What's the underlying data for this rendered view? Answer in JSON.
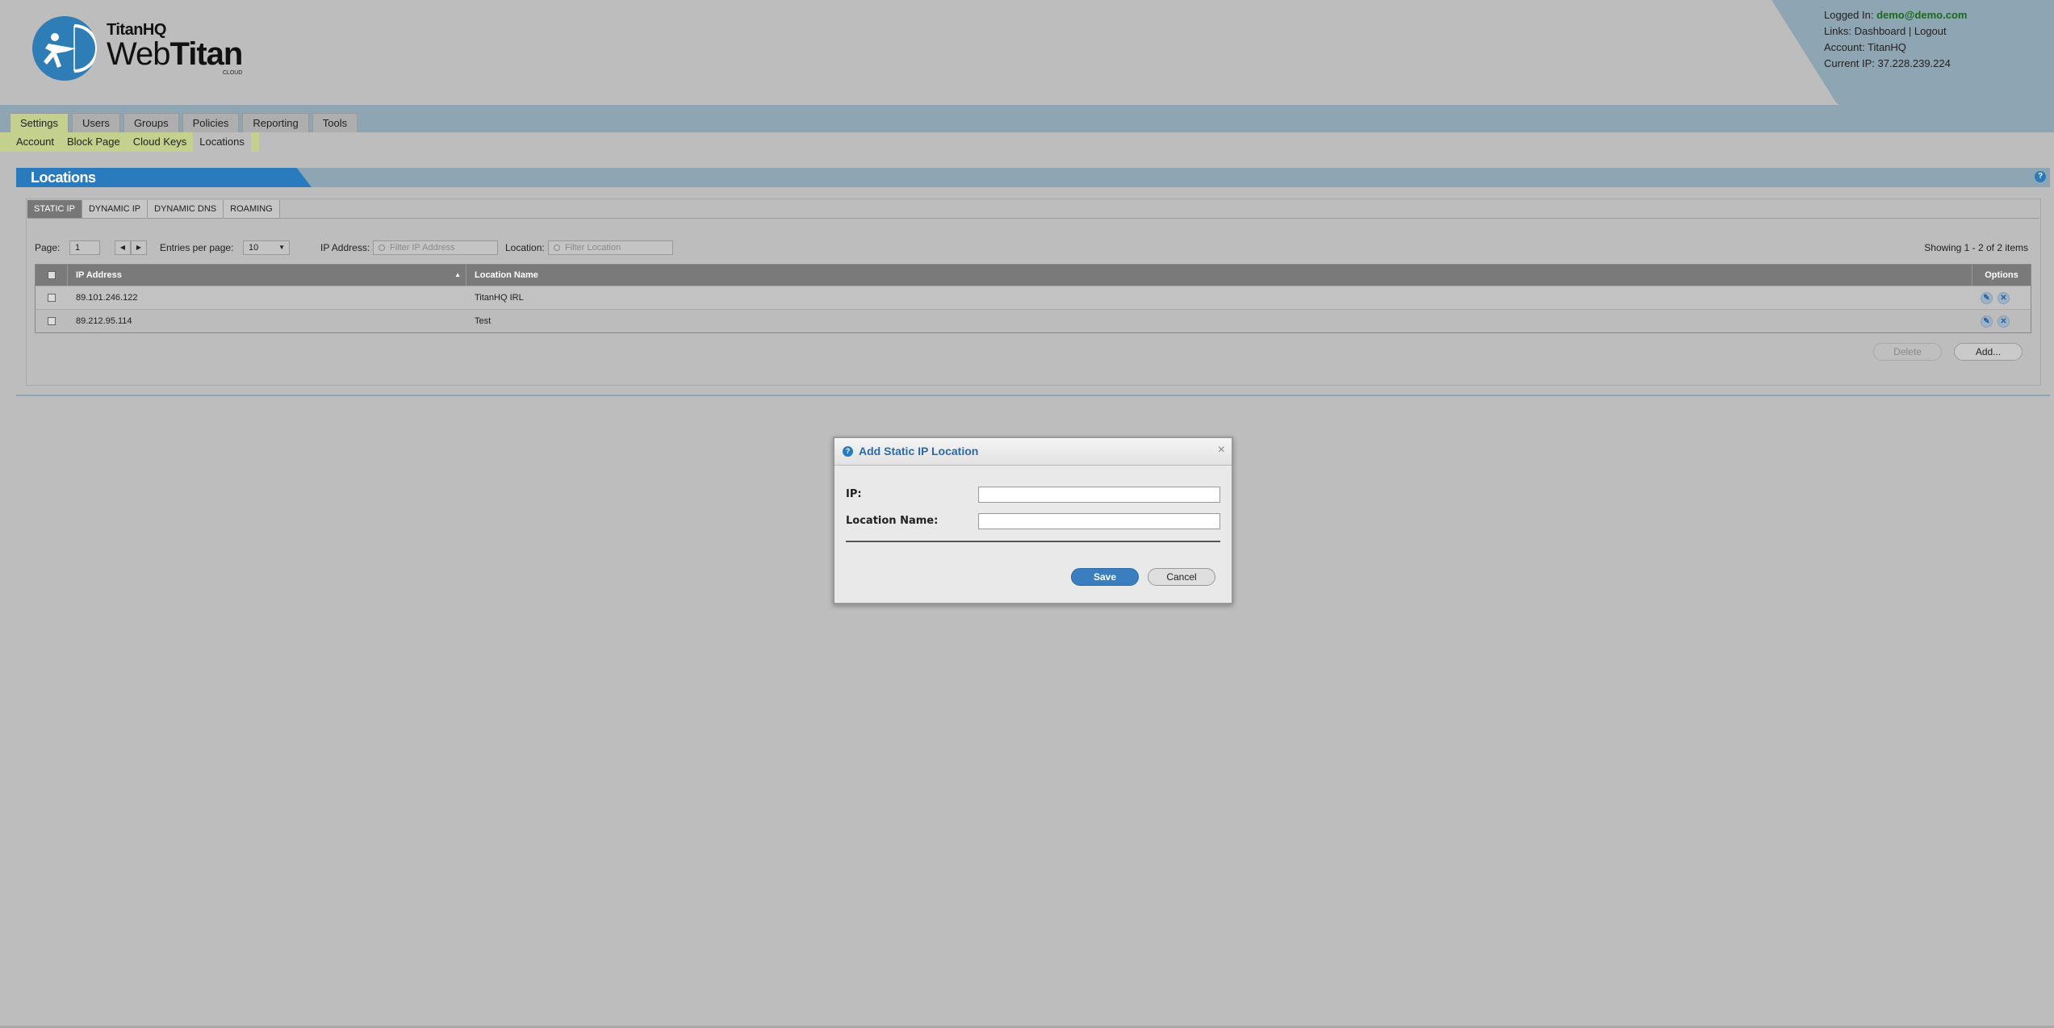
{
  "header": {
    "brand": "TitanHQ",
    "product_light": "Web",
    "product_bold": "Titan",
    "product_tag": "CLOUD"
  },
  "userinfo": {
    "logged_in_label": "Logged In:",
    "logged_in_value": "demo@demo.com",
    "links_label": "Links:",
    "link_dashboard": "Dashboard",
    "link_sep": "|",
    "link_logout": "Logout",
    "account_label": "Account:",
    "account_value": "TitanHQ",
    "ip_label": "Current IP:",
    "ip_value": "37.228.239.224"
  },
  "mainnav": {
    "items": [
      {
        "label": "Settings"
      },
      {
        "label": "Users"
      },
      {
        "label": "Groups"
      },
      {
        "label": "Policies"
      },
      {
        "label": "Reporting"
      },
      {
        "label": "Tools"
      }
    ]
  },
  "subnav": {
    "items": [
      {
        "label": "Account"
      },
      {
        "label": "Block Page"
      },
      {
        "label": "Cloud Keys"
      },
      {
        "label": "Locations"
      }
    ]
  },
  "panel": {
    "title": "Locations",
    "help": "?",
    "tabs": [
      {
        "label": "STATIC IP"
      },
      {
        "label": "DYNAMIC IP"
      },
      {
        "label": "DYNAMIC DNS"
      },
      {
        "label": "ROAMING"
      }
    ]
  },
  "toolbar": {
    "page_label": "Page:",
    "page_value": "1",
    "prev": "◀",
    "next": "▶",
    "entries_label": "Entries per page:",
    "entries_value": "10",
    "ip_filter_label": "IP Address:",
    "ip_filter_placeholder": "Filter IP Address",
    "location_filter_label": "Location:",
    "location_filter_placeholder": "Filter Location",
    "showing": "Showing 1 - 2 of 2 items"
  },
  "grid": {
    "columns": [
      "IP Address",
      "Location Name",
      "Options"
    ],
    "rows": [
      {
        "ip": "89.101.246.122",
        "location": "TitanHQ IRL"
      },
      {
        "ip": "89.212.95.114",
        "location": "Test"
      }
    ]
  },
  "actions": {
    "delete": "Delete",
    "add": "Add..."
  },
  "dialog": {
    "title": "Add Static IP Location",
    "close": "×",
    "ip_label": "IP:",
    "ip_value": "",
    "location_label": "Location Name:",
    "location_value": "",
    "save": "Save",
    "cancel": "Cancel"
  }
}
